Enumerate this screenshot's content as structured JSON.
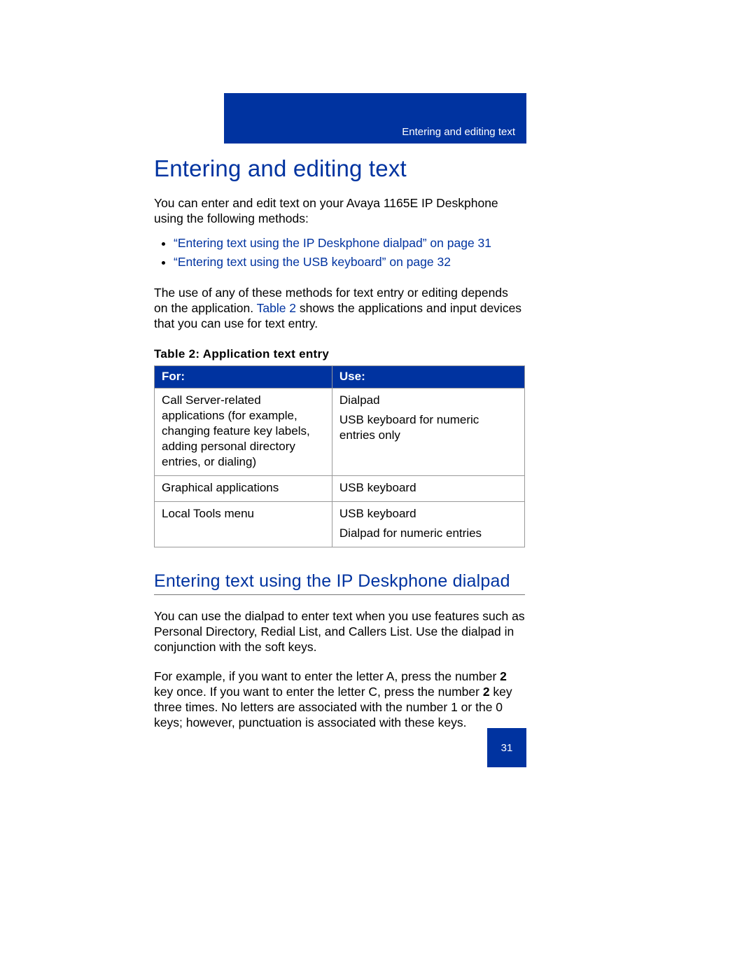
{
  "header": {
    "running_title": "Entering and editing text"
  },
  "title": "Entering and editing text",
  "intro": "You can enter and edit text on your Avaya 1165E IP Deskphone using the following methods:",
  "bullets": [
    "“Entering text using the IP Deskphone dialpad” on page 31",
    "“Entering text using the USB keyboard” on page 32"
  ],
  "after_bullets_pre": "The use of any of these methods for text entry or editing depends on the application. ",
  "after_bullets_xref": "Table 2",
  "after_bullets_post": " shows the applications and input devices that you can use for text entry.",
  "table": {
    "caption": "Table 2: Application text entry",
    "headers": {
      "for": "For:",
      "use": "Use:"
    },
    "rows": [
      {
        "for": "Call Server-related applications (for example, changing feature key labels, adding personal directory entries, or dialing)",
        "use_main": "Dialpad",
        "use_sub": "USB keyboard for numeric entries only"
      },
      {
        "for": "Graphical applications",
        "use_main": "USB keyboard",
        "use_sub": ""
      },
      {
        "for": "Local Tools menu",
        "use_main": "USB keyboard",
        "use_sub": "Dialpad for numeric entries"
      }
    ]
  },
  "section": {
    "title": "Entering text using the IP Deskphone dialpad",
    "p1": "You can use the dialpad to enter text when you use features such as Personal Directory, Redial List, and Callers List. Use the dialpad in conjunction with the soft keys.",
    "p2_pre": "For example, if you want to enter the letter A, press the number ",
    "p2_b1": "2",
    "p2_mid": " key once. If you want to enter the letter C, press the number ",
    "p2_b2": "2",
    "p2_post": " key three times. No letters are associated with the number 1 or the 0 keys; however, punctuation is associated with these keys."
  },
  "page_number": "31"
}
